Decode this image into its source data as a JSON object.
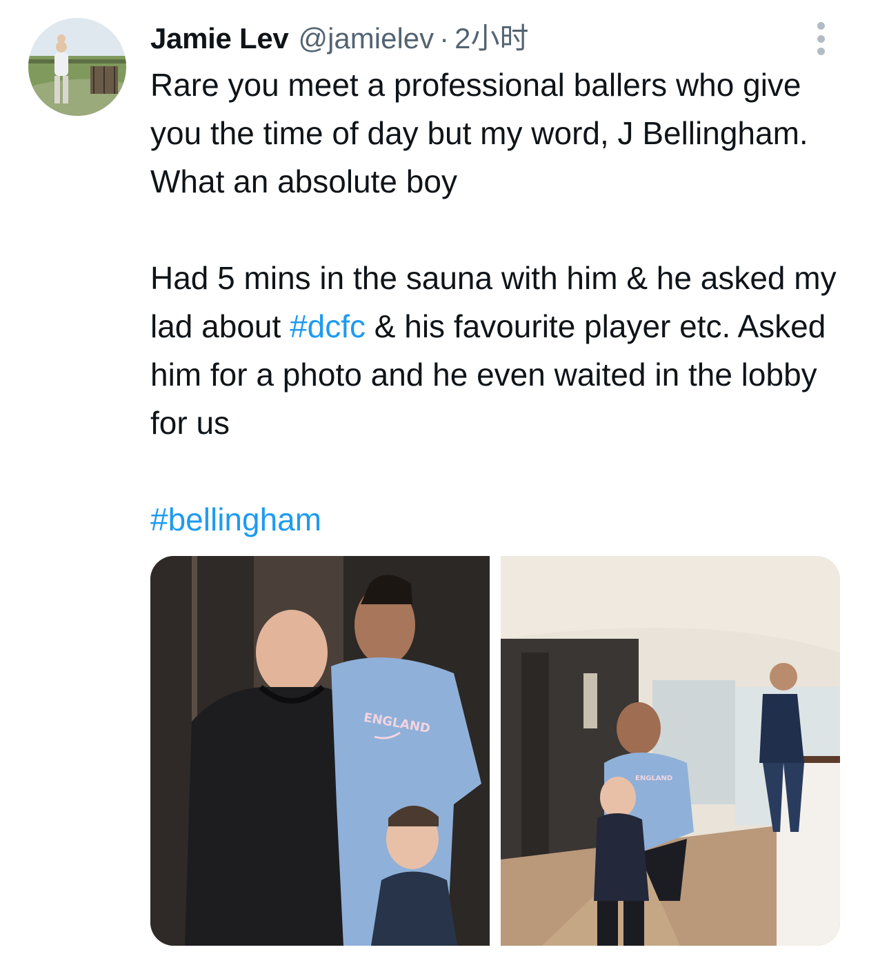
{
  "tweet": {
    "author": {
      "display_name": "Jamie Lev",
      "handle": "@jamielev",
      "separator": "·",
      "time": "2小时"
    },
    "more_icon": "more-vertical-icon",
    "text": {
      "p1": "Rare you meet a professional ballers who give you the time of day but my word, J Bellingham. What an absolute boy",
      "p2_before": "Had 5 mins in the sauna with him & he asked my lad about ",
      "p2_hashtag": "#dcfc",
      "p2_after": " & his favourite player etc. Asked him for a photo and he even waited in the lobby for us",
      "p3_hashtag": "#bellingham"
    },
    "media": {
      "photo1_shirt_text": "ENGLAND",
      "photo2_shirt_text": "ENGLAND"
    },
    "colors": {
      "link": "#1d9bf0",
      "text": "#0f1419",
      "secondary": "#536471"
    }
  }
}
